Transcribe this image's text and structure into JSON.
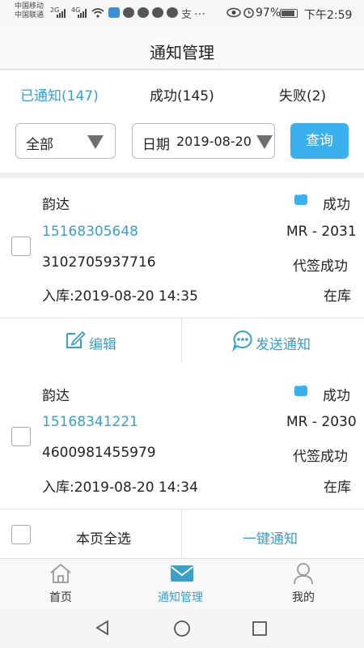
{
  "status_bar": {
    "carrier1": "中国移动",
    "carrier2": "中国联通",
    "signal1": "2G",
    "signal2": "4G",
    "more": "…",
    "battery": "97%",
    "time": "下午2:59"
  },
  "header": {
    "title": "通知管理"
  },
  "tabs": [
    {
      "label": "已通知(147)"
    },
    {
      "label": "成功(145)"
    },
    {
      "label": "失败(2)"
    }
  ],
  "filters": {
    "type_value": "全部",
    "date_label": "日期",
    "date_value": "2019-08-20",
    "query_label": "查询"
  },
  "records": [
    {
      "courier": "韵达",
      "status": "成功",
      "phone": "15168305648",
      "shelf_code": "MR - 2031",
      "tracking_no": "3102705937716",
      "sign_status": "代签成功",
      "stock_in": "入库:2019-08-20 14:35",
      "stock_status": "在库",
      "edit_label": "编辑",
      "notify_label": "发送通知"
    },
    {
      "courier": "韵达",
      "status": "成功",
      "phone": "15168341221",
      "shelf_code": "MR - 2030",
      "tracking_no": "4600981455979",
      "sign_status": "代签成功",
      "stock_in": "入库:2019-08-20 14:34",
      "stock_status": "在库"
    }
  ],
  "bulk_bar": {
    "select_all_label": "本页全选",
    "notify_all_label": "一键通知"
  },
  "bottom_nav": {
    "items": [
      {
        "label": "首页",
        "icon": "home-icon"
      },
      {
        "label": "通知管理",
        "icon": "mail-icon",
        "active": true
      },
      {
        "label": "我的",
        "icon": "user-icon"
      }
    ]
  },
  "colors": {
    "accent": "#3aa0c8",
    "button": "#3ab0ef"
  }
}
